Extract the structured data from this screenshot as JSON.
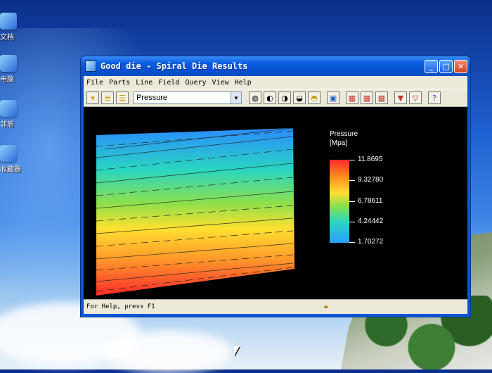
{
  "desktop": {
    "icons": [
      {
        "label": "文档",
        "icon": "document-icon"
      },
      {
        "label": "电脑",
        "icon": "computer-icon"
      },
      {
        "label": "邻居",
        "icon": "network-icon"
      },
      {
        "label": "收藏器",
        "icon": "recycle-icon"
      }
    ]
  },
  "window": {
    "title": "Good die - Spiral Die Results",
    "controls": {
      "minimize": "_",
      "maximize": "□",
      "close": "✕"
    }
  },
  "menu": [
    "File",
    "Parts",
    "Line",
    "Field",
    "Query",
    "View",
    "Help"
  ],
  "toolbar": {
    "field_select_value": "Pressure",
    "tools_left": [
      "tool-1-icon",
      "tool-2-icon",
      "tool-3-icon"
    ],
    "tools_right": [
      "view-1-icon",
      "view-2-icon",
      "view-3-icon",
      "view-4-icon",
      "view-5-icon",
      "window-icon",
      "grid-1-icon",
      "grid-2-icon",
      "grid-3-icon",
      "down-arrow-icon",
      "down-arrow-2-icon",
      "help-icon"
    ]
  },
  "legend": {
    "title": "Pressure",
    "unit": "[Mpa]",
    "values": [
      "11.8695",
      "9.32780",
      "6.78611",
      "4.24442",
      "1.70272"
    ]
  },
  "status": {
    "text": "For Help, press F1"
  }
}
